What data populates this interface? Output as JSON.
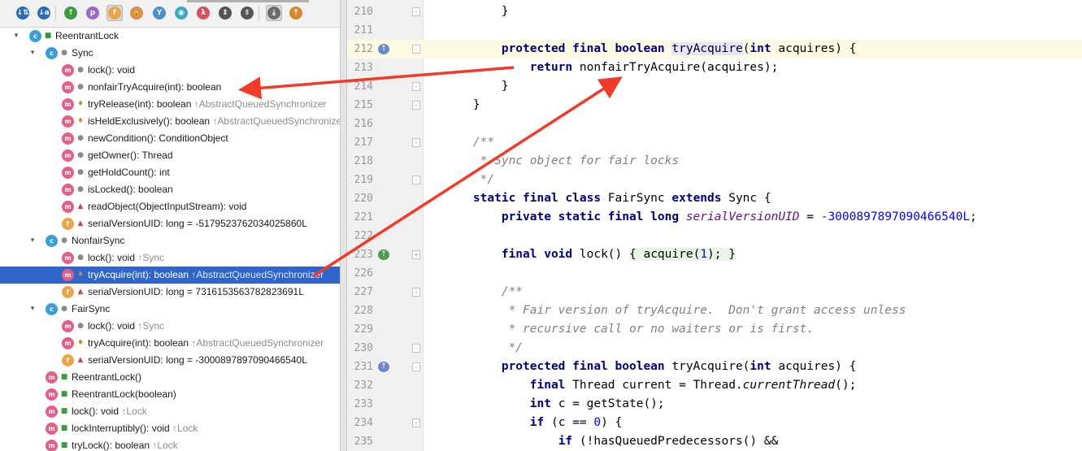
{
  "toolbar": {
    "buttons": [
      {
        "name": "sort-by-visibility-icon",
        "glyph": "↓⇅",
        "color": "#2a6bb8"
      },
      {
        "name": "sort-alphabetically-icon",
        "glyph": "↓a",
        "color": "#2a6bb8"
      },
      {
        "name": "show-inherited-icon",
        "glyph": "↑",
        "color": "#3d9a3d"
      },
      {
        "name": "show-properties-icon",
        "glyph": "p",
        "color": "#9a6ac9"
      },
      {
        "name": "show-fields-icon",
        "glyph": "f",
        "color": "#eaa54a"
      },
      {
        "name": "show-non-public-icon",
        "glyph": "🔒",
        "color": "#e08a58"
      },
      {
        "name": "show-anonymous-classes-icon",
        "glyph": "Y",
        "color": "#4d8fcf"
      },
      {
        "name": "show-lambdas-icon",
        "glyph": "◉",
        "color": "#3aa9c9"
      },
      {
        "name": "show-lambda-icon",
        "glyph": "λ",
        "color": "#d2535f"
      },
      {
        "name": "expand-all-icon",
        "glyph": "⇕",
        "color": "#555555"
      },
      {
        "name": "collapse-all-icon",
        "glyph": "⇳",
        "color": "#555555"
      },
      {
        "name": "autoscroll-to-source-icon",
        "glyph": "⤓",
        "color": "#6b6b6b"
      },
      {
        "name": "autoscroll-from-source-icon",
        "glyph": "⤒",
        "color": "#d6872e"
      }
    ]
  },
  "tree": {
    "items": [
      {
        "indent": 0,
        "arrow": "▾",
        "icon": "c",
        "vis": "pub",
        "label": "ReentrantLock",
        "inherited": ""
      },
      {
        "indent": 1,
        "arrow": "▾",
        "icon": "c",
        "vis": "pkg",
        "label": "Sync",
        "inherited": ""
      },
      {
        "indent": 2,
        "arrow": "",
        "icon": "m",
        "vis": "pkg",
        "label": "lock(): void",
        "inherited": ""
      },
      {
        "indent": 2,
        "arrow": "",
        "icon": "m",
        "vis": "pkg",
        "label": "nonfairTryAcquire(int): boolean",
        "inherited": ""
      },
      {
        "indent": 2,
        "arrow": "",
        "icon": "m",
        "vis": "prot",
        "label": "tryRelease(int): boolean ",
        "inherited": "↑AbstractQueuedSynchronizer"
      },
      {
        "indent": 2,
        "arrow": "",
        "icon": "m",
        "vis": "prot",
        "label": "isHeldExclusively(): boolean ",
        "inherited": "↑AbstractQueuedSynchronizer"
      },
      {
        "indent": 2,
        "arrow": "",
        "icon": "m",
        "vis": "pkg",
        "label": "newCondition(): ConditionObject",
        "inherited": ""
      },
      {
        "indent": 2,
        "arrow": "",
        "icon": "m",
        "vis": "pkg",
        "label": "getOwner(): Thread",
        "inherited": ""
      },
      {
        "indent": 2,
        "arrow": "",
        "icon": "m",
        "vis": "pkg",
        "label": "getHoldCount(): int",
        "inherited": ""
      },
      {
        "indent": 2,
        "arrow": "",
        "icon": "m",
        "vis": "pkg",
        "label": "isLocked(): boolean",
        "inherited": ""
      },
      {
        "indent": 2,
        "arrow": "",
        "icon": "m",
        "vis": "priv",
        "label": "readObject(ObjectInputStream): void",
        "inherited": ""
      },
      {
        "indent": 2,
        "arrow": "",
        "icon": "f",
        "vis": "priv",
        "label": "serialVersionUID: long = -5179523762034025860L",
        "inherited": ""
      },
      {
        "indent": 1,
        "arrow": "▾",
        "icon": "c",
        "vis": "pkg",
        "label": "NonfairSync",
        "inherited": ""
      },
      {
        "indent": 2,
        "arrow": "",
        "icon": "m",
        "vis": "pkg",
        "label": "lock(): void ",
        "inherited": "↑Sync"
      },
      {
        "indent": 2,
        "arrow": "",
        "icon": "m",
        "vis": "prot",
        "label": "tryAcquire(int): boolean ",
        "inherited": "↑AbstractQueuedSynchronizer",
        "selected": true
      },
      {
        "indent": 2,
        "arrow": "",
        "icon": "f",
        "vis": "priv",
        "label": "serialVersionUID: long = 7316153563782823691L",
        "inherited": ""
      },
      {
        "indent": 1,
        "arrow": "▾",
        "icon": "c",
        "vis": "pkg",
        "label": "FairSync",
        "inherited": ""
      },
      {
        "indent": 2,
        "arrow": "",
        "icon": "m",
        "vis": "pkg",
        "label": "lock(): void ",
        "inherited": "↑Sync"
      },
      {
        "indent": 2,
        "arrow": "",
        "icon": "m",
        "vis": "prot",
        "label": "tryAcquire(int): boolean ",
        "inherited": "↑AbstractQueuedSynchronizer"
      },
      {
        "indent": 2,
        "arrow": "",
        "icon": "f",
        "vis": "priv",
        "label": "serialVersionUID: long = -3000897897090466540L",
        "inherited": ""
      },
      {
        "indent": 1,
        "arrow": "",
        "icon": "m",
        "vis": "pub",
        "label": "ReentrantLock()",
        "inherited": ""
      },
      {
        "indent": 1,
        "arrow": "",
        "icon": "m",
        "vis": "pub",
        "label": "ReentrantLock(boolean)",
        "inherited": ""
      },
      {
        "indent": 1,
        "arrow": "",
        "icon": "m",
        "vis": "pub",
        "label": "lock(): void ",
        "inherited": "↑Lock"
      },
      {
        "indent": 1,
        "arrow": "",
        "icon": "m",
        "vis": "pub",
        "label": "lockInterruptibly(): void ",
        "inherited": "↑Lock"
      },
      {
        "indent": 1,
        "arrow": "",
        "icon": "m",
        "vis": "pub",
        "label": "tryLock(): boolean ",
        "inherited": "↑Lock"
      }
    ]
  },
  "editor": {
    "lines": [
      {
        "num": "210",
        "fold": "-",
        "segs": [
          {
            "t": "        }",
            "c": ""
          }
        ]
      },
      {
        "num": "211",
        "fold": "",
        "segs": []
      },
      {
        "num": "212",
        "fold": "-",
        "mark": "impl",
        "highlight": true,
        "segs": [
          {
            "t": "        ",
            "c": ""
          },
          {
            "t": "protected final boolean",
            "c": "kw"
          },
          {
            "t": " ",
            "c": ""
          },
          {
            "t": "tryAcquire",
            "c": "usage"
          },
          {
            "t": "(",
            "c": ""
          },
          {
            "t": "int",
            "c": "kw"
          },
          {
            "t": " acquires) {",
            "c": ""
          }
        ]
      },
      {
        "num": "213",
        "fold": "",
        "segs": [
          {
            "t": "            ",
            "c": ""
          },
          {
            "t": "return",
            "c": "kw"
          },
          {
            "t": " nonfairTryAcquire(acquires);",
            "c": ""
          }
        ]
      },
      {
        "num": "214",
        "fold": "-",
        "segs": [
          {
            "t": "        }",
            "c": ""
          }
        ]
      },
      {
        "num": "215",
        "fold": "-",
        "segs": [
          {
            "t": "    }",
            "c": ""
          }
        ]
      },
      {
        "num": "216",
        "fold": "",
        "segs": []
      },
      {
        "num": "217",
        "fold": "-",
        "segs": [
          {
            "t": "    /**",
            "c": "cm"
          }
        ]
      },
      {
        "num": "218",
        "fold": "",
        "segs": [
          {
            "t": "     * Sync object for fair locks",
            "c": "cm"
          }
        ]
      },
      {
        "num": "219",
        "fold": "-",
        "segs": [
          {
            "t": "     */",
            "c": "cm"
          }
        ]
      },
      {
        "num": "220",
        "fold": "",
        "segs": [
          {
            "t": "    ",
            "c": ""
          },
          {
            "t": "static final class",
            "c": "kw"
          },
          {
            "t": " FairSync ",
            "c": ""
          },
          {
            "t": "extends",
            "c": "kw"
          },
          {
            "t": " Sync {",
            "c": ""
          }
        ]
      },
      {
        "num": "221",
        "fold": "",
        "segs": [
          {
            "t": "        ",
            "c": ""
          },
          {
            "t": "private static final long",
            "c": "kw"
          },
          {
            "t": " ",
            "c": ""
          },
          {
            "t": "serialVersionUID",
            "c": "sf"
          },
          {
            "t": " = ",
            "c": ""
          },
          {
            "t": "-3000897897090466540L",
            "c": "num"
          },
          {
            "t": ";",
            "c": ""
          }
        ]
      },
      {
        "num": "222",
        "fold": "",
        "segs": []
      },
      {
        "num": "223",
        "fold": "+",
        "mark": "ovr",
        "segs": [
          {
            "t": "        ",
            "c": ""
          },
          {
            "t": "final void",
            "c": "kw"
          },
          {
            "t": " lock() ",
            "c": ""
          },
          {
            "t": "{ acquire(",
            "c": "fb"
          },
          {
            "t": "1",
            "c": "num fb"
          },
          {
            "t": "); }",
            "c": "fb"
          }
        ]
      },
      {
        "num": "226",
        "fold": "",
        "segs": []
      },
      {
        "num": "227",
        "fold": "-",
        "segs": [
          {
            "t": "        /**",
            "c": "cm"
          }
        ]
      },
      {
        "num": "228",
        "fold": "",
        "segs": [
          {
            "t": "         * Fair version of tryAcquire.  Don't grant access unless",
            "c": "cm"
          }
        ]
      },
      {
        "num": "229",
        "fold": "",
        "segs": [
          {
            "t": "         * recursive call or no waiters or is first.",
            "c": "cm"
          }
        ]
      },
      {
        "num": "230",
        "fold": "-",
        "segs": [
          {
            "t": "         */",
            "c": "cm"
          }
        ]
      },
      {
        "num": "231",
        "fold": "-",
        "mark": "impl",
        "segs": [
          {
            "t": "        ",
            "c": ""
          },
          {
            "t": "protected final boolean",
            "c": "kw"
          },
          {
            "t": " tryAcquire(",
            "c": ""
          },
          {
            "t": "int",
            "c": "kw"
          },
          {
            "t": " acquires) {",
            "c": ""
          }
        ]
      },
      {
        "num": "232",
        "fold": "",
        "segs": [
          {
            "t": "            ",
            "c": ""
          },
          {
            "t": "final",
            "c": "kw"
          },
          {
            "t": " Thread current = Thread.",
            "c": ""
          },
          {
            "t": "currentThread",
            "c": "it"
          },
          {
            "t": "();",
            "c": ""
          }
        ]
      },
      {
        "num": "233",
        "fold": "",
        "segs": [
          {
            "t": "            ",
            "c": ""
          },
          {
            "t": "int",
            "c": "kw"
          },
          {
            "t": " c = getState();",
            "c": ""
          }
        ]
      },
      {
        "num": "234",
        "fold": "-",
        "segs": [
          {
            "t": "            ",
            "c": ""
          },
          {
            "t": "if",
            "c": "kw"
          },
          {
            "t": " (c == ",
            "c": ""
          },
          {
            "t": "0",
            "c": "num"
          },
          {
            "t": ") {",
            "c": ""
          }
        ]
      },
      {
        "num": "235",
        "fold": "",
        "segs": [
          {
            "t": "                ",
            "c": ""
          },
          {
            "t": "if",
            "c": "kw"
          },
          {
            "t": " (!hasQueuedPredecessors() &&",
            "c": ""
          }
        ]
      }
    ]
  },
  "colors": {
    "annotation_arrow": "#f03a2a",
    "selection": "#2f65ca"
  }
}
